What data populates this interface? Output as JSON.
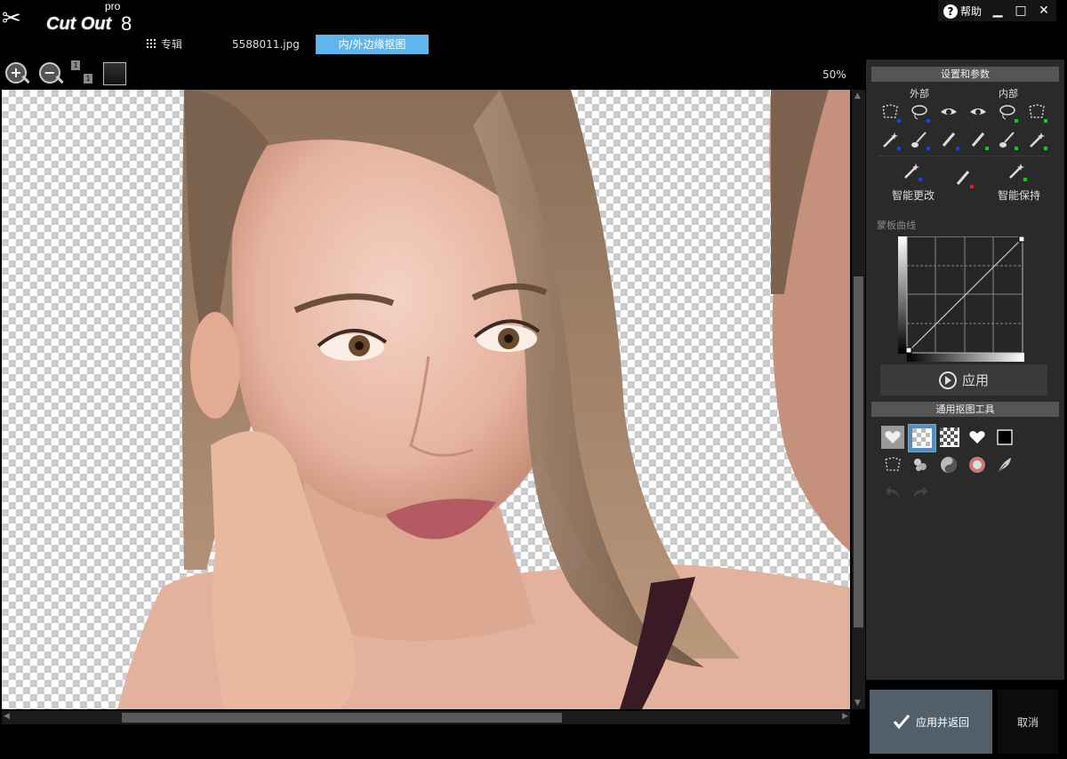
{
  "app": {
    "logo_text": "Cut Out",
    "logo_edition": "pro",
    "logo_version": "8"
  },
  "tabs": {
    "album_label": "专辑",
    "file_label": "5588011.jpg",
    "active_label": "内/外边缘抠图"
  },
  "window": {
    "help_label": "帮助"
  },
  "toolbar": {
    "zoom_level": "50%"
  },
  "settings_panel": {
    "title": "设置和参数",
    "outside_label": "外部",
    "inside_label": "内部",
    "smart_change_label": "智能更改",
    "smart_keep_label": "智能保持",
    "mask_curve_label": "蒙板曲线",
    "apply_label": "应用"
  },
  "tools_panel": {
    "title": "通用抠图工具"
  },
  "footer": {
    "ok_label": "应用并返回",
    "cancel_label": "取消"
  },
  "colors": {
    "accent": "#5fb6ef",
    "outside_marker": "#1a3cff",
    "inside_marker": "#1ec41e",
    "smart_marker": "#e02020",
    "ok_button": "#52606c"
  },
  "icons": [
    "add-icon",
    "zoom-in-icon",
    "zoom-out-icon",
    "actual-size-icon",
    "fit-screen-icon",
    "help-icon",
    "minimize-icon",
    "maximize-icon",
    "close-icon",
    "lasso-icon",
    "eye-icon",
    "magic-wand-icon",
    "brush-icon",
    "pencil-icon",
    "play-icon",
    "check-icon",
    "undo-icon",
    "redo-icon",
    "feather-icon"
  ]
}
